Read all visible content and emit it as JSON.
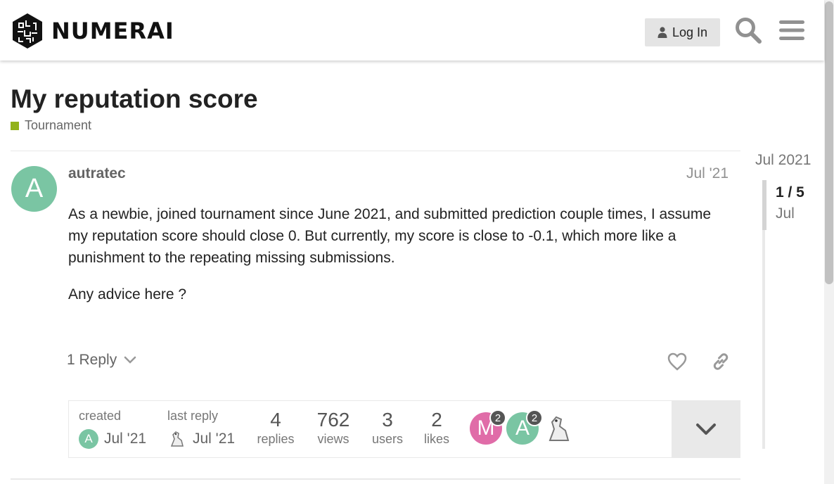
{
  "header": {
    "logo_text": "NUMERAI",
    "login_label": "Log In",
    "icons": [
      "search-icon",
      "hamburger-menu-icon",
      "user-icon"
    ]
  },
  "topic": {
    "title": "My reputation score",
    "category": "Tournament",
    "category_color": "#92b21a"
  },
  "post": {
    "avatar_letter": "A",
    "avatar_color": "#7ac5a3",
    "username": "autratec",
    "date": "Jul '21",
    "body": [
      "As a newbie, joined tournament since June 2021, and submitted prediction couple times, I assume my reputation score should close 0. But currently, my score is close to -0.1, which more like a punishment to the repeating missing submissions.",
      "Any advice here ?"
    ],
    "reply_label": "1 Reply"
  },
  "topic_map": {
    "created_label": "created",
    "created_date": "Jul '21",
    "last_reply_label": "last reply",
    "last_reply_date": "Jul '21",
    "stats": [
      {
        "num": "4",
        "label": "replies"
      },
      {
        "num": "762",
        "label": "views"
      },
      {
        "num": "3",
        "label": "users"
      },
      {
        "num": "2",
        "label": "likes"
      }
    ],
    "participants": [
      {
        "letter": "M",
        "color": "#e06ca8",
        "count": "2"
      },
      {
        "letter": "A",
        "color": "#7ac5a3",
        "count": "2"
      }
    ]
  },
  "timeline": {
    "top_date": "Jul 2021",
    "position": "1 / 5",
    "current_date": "Jul"
  }
}
